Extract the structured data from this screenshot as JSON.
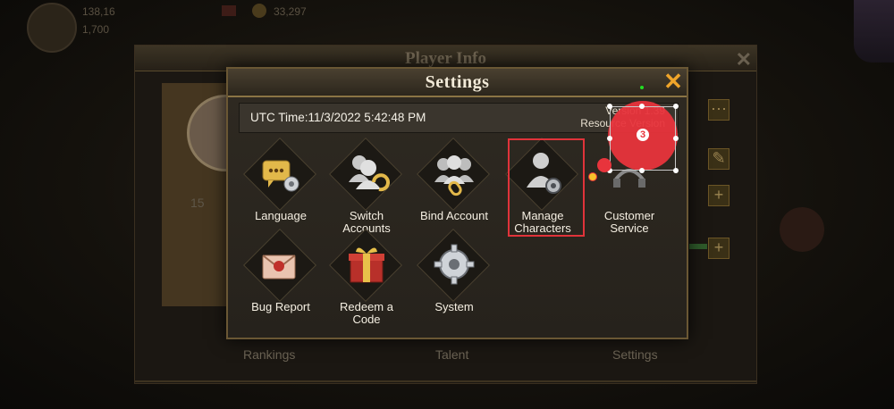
{
  "background": {
    "hud": {
      "stat1": "138,16",
      "stat2": "1,700",
      "coins": "33,297"
    },
    "player_info": {
      "title": "Player Info",
      "stat": "15",
      "tabs": [
        "Rankings",
        "Talent",
        "Settings"
      ]
    }
  },
  "settings": {
    "title": "Settings",
    "utc_time": "UTC Time:11/3/2022 5:42:48 PM",
    "version_line1": "Version 1.39",
    "version_line2": "Resource Version",
    "items": [
      {
        "label": "Language",
        "icon": "language-icon"
      },
      {
        "label": "Switch\nAccounts",
        "icon": "switch-accounts-icon"
      },
      {
        "label": "Bind Account",
        "icon": "bind-account-icon"
      },
      {
        "label": "Manage\nCharacters",
        "icon": "manage-characters-icon"
      },
      {
        "label": "Customer\nService",
        "icon": "customer-service-icon"
      },
      {
        "label": "Bug Report",
        "icon": "bug-report-icon"
      },
      {
        "label": "Redeem a\nCode",
        "icon": "redeem-code-icon"
      },
      {
        "label": "System",
        "icon": "system-gear-icon"
      }
    ]
  },
  "annotation": {
    "step_number": "3",
    "highlight_color": "#e0333a",
    "marker_color": "#e8343c"
  }
}
